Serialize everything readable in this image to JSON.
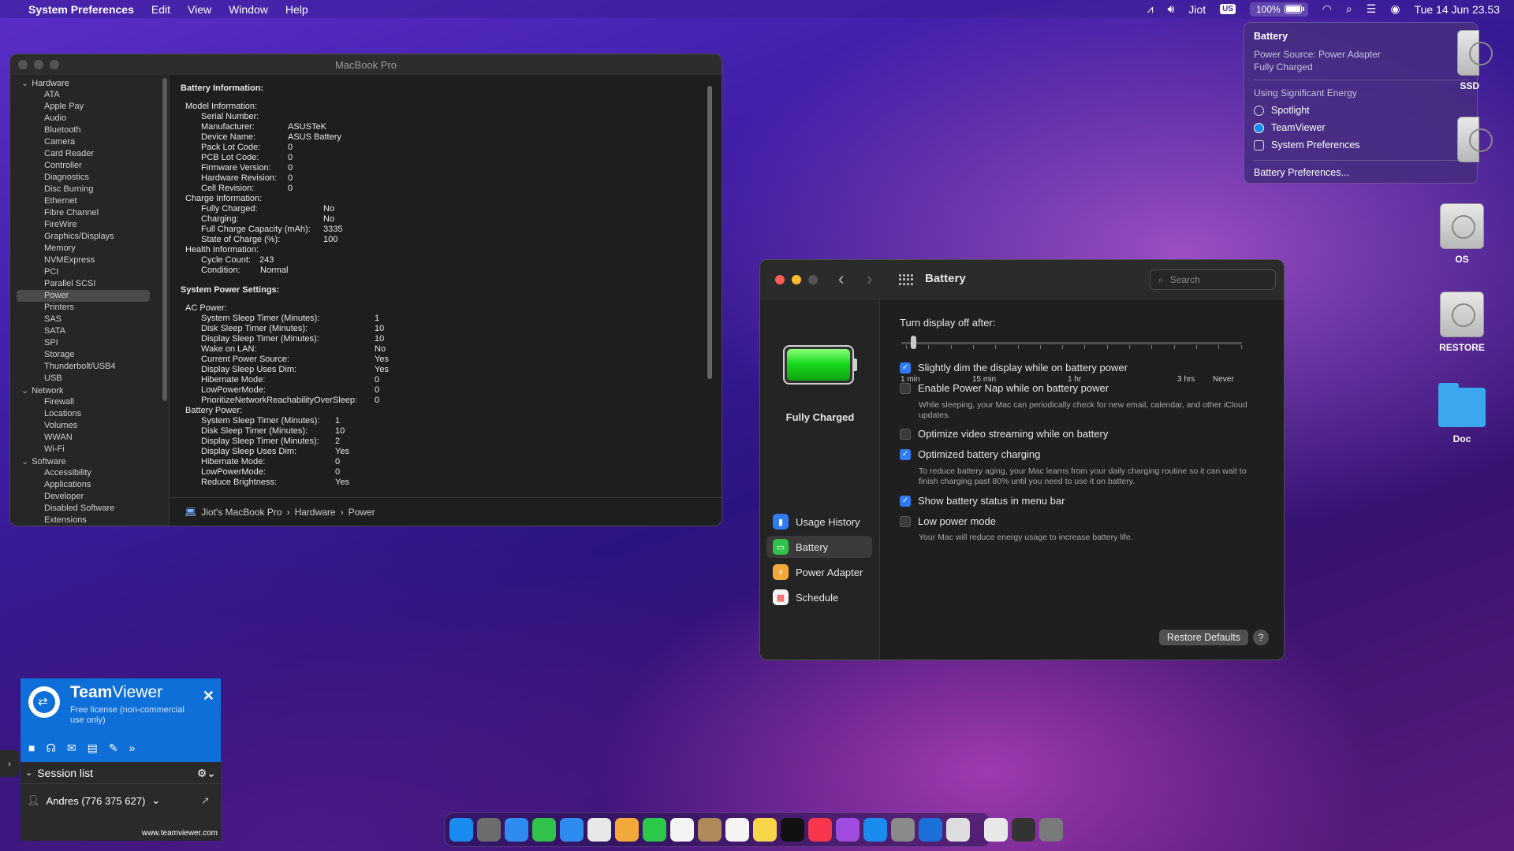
{
  "menubar": {
    "app_name": "System Preferences",
    "menus": [
      "Edit",
      "View",
      "Window",
      "Help"
    ],
    "user": "Jiot",
    "input_source": "US",
    "battery_percent": "100%",
    "datetime": "Tue 14 Jun  23.53"
  },
  "sysinfo": {
    "title": "MacBook Pro",
    "sidebar": [
      {
        "type": "cat",
        "label": "Hardware"
      },
      {
        "type": "item",
        "label": "ATA"
      },
      {
        "type": "item",
        "label": "Apple Pay"
      },
      {
        "type": "item",
        "label": "Audio"
      },
      {
        "type": "item",
        "label": "Bluetooth"
      },
      {
        "type": "item",
        "label": "Camera"
      },
      {
        "type": "item",
        "label": "Card Reader"
      },
      {
        "type": "item",
        "label": "Controller"
      },
      {
        "type": "item",
        "label": "Diagnostics"
      },
      {
        "type": "item",
        "label": "Disc Burning"
      },
      {
        "type": "item",
        "label": "Ethernet"
      },
      {
        "type": "item",
        "label": "Fibre Channel"
      },
      {
        "type": "item",
        "label": "FireWire"
      },
      {
        "type": "item",
        "label": "Graphics/Displays"
      },
      {
        "type": "item",
        "label": "Memory"
      },
      {
        "type": "item",
        "label": "NVMExpress"
      },
      {
        "type": "item",
        "label": "PCI"
      },
      {
        "type": "item",
        "label": "Parallel SCSI"
      },
      {
        "type": "item",
        "label": "Power",
        "selected": true
      },
      {
        "type": "item",
        "label": "Printers"
      },
      {
        "type": "item",
        "label": "SAS"
      },
      {
        "type": "item",
        "label": "SATA"
      },
      {
        "type": "item",
        "label": "SPI"
      },
      {
        "type": "item",
        "label": "Storage"
      },
      {
        "type": "item",
        "label": "Thunderbolt/USB4"
      },
      {
        "type": "item",
        "label": "USB"
      },
      {
        "type": "cat",
        "label": "Network"
      },
      {
        "type": "item",
        "label": "Firewall"
      },
      {
        "type": "item",
        "label": "Locations"
      },
      {
        "type": "item",
        "label": "Volumes"
      },
      {
        "type": "item",
        "label": "WWAN"
      },
      {
        "type": "item",
        "label": "Wi-Fi"
      },
      {
        "type": "cat",
        "label": "Software"
      },
      {
        "type": "item",
        "label": "Accessibility"
      },
      {
        "type": "item",
        "label": "Applications"
      },
      {
        "type": "item",
        "label": "Developer"
      },
      {
        "type": "item",
        "label": "Disabled Software"
      },
      {
        "type": "item",
        "label": "Extensions"
      }
    ],
    "battery_heading": "Battery Information:",
    "battery_rows": [
      {
        "lvl": 1,
        "k": "Model Information:",
        "v": ""
      },
      {
        "lvl": 2,
        "k": "Serial Number:",
        "v": ""
      },
      {
        "lvl": 2,
        "k": "Manufacturer:",
        "v": "ASUSTeK"
      },
      {
        "lvl": 2,
        "k": "Device Name:",
        "v": "ASUS Battery"
      },
      {
        "lvl": 2,
        "k": "Pack Lot Code:",
        "v": "0"
      },
      {
        "lvl": 2,
        "k": "PCB Lot Code:",
        "v": "0"
      },
      {
        "lvl": 2,
        "k": "Firmware Version:",
        "v": "0"
      },
      {
        "lvl": 2,
        "k": "Hardware Revision:",
        "v": "0"
      },
      {
        "lvl": 2,
        "k": "Cell Revision:",
        "v": "0"
      },
      {
        "lvl": 1,
        "k": "Charge Information:",
        "v": ""
      },
      {
        "lvl": 2,
        "k": "Fully Charged:",
        "v": "No"
      },
      {
        "lvl": 2,
        "k": "Charging:",
        "v": "No"
      },
      {
        "lvl": 2,
        "k": "Full Charge Capacity (mAh):",
        "v": "3335"
      },
      {
        "lvl": 2,
        "k": "State of Charge (%):",
        "v": "100"
      },
      {
        "lvl": 1,
        "k": "Health Information:",
        "v": ""
      },
      {
        "lvl": 2,
        "k": "Cycle Count:",
        "v": "243"
      },
      {
        "lvl": 2,
        "k": "Condition:",
        "v": "Normal"
      }
    ],
    "power_heading": "System Power Settings:",
    "power_rows": [
      {
        "lvl": 1,
        "k": "AC Power:",
        "v": ""
      },
      {
        "lvl": 2,
        "k": "System Sleep Timer (Minutes):",
        "v": "1"
      },
      {
        "lvl": 2,
        "k": "Disk Sleep Timer (Minutes):",
        "v": "10"
      },
      {
        "lvl": 2,
        "k": "Display Sleep Timer (Minutes):",
        "v": "10"
      },
      {
        "lvl": 2,
        "k": "Wake on LAN:",
        "v": "No"
      },
      {
        "lvl": 2,
        "k": "Current Power Source:",
        "v": "Yes"
      },
      {
        "lvl": 2,
        "k": "Display Sleep Uses Dim:",
        "v": "Yes"
      },
      {
        "lvl": 2,
        "k": "Hibernate Mode:",
        "v": "0"
      },
      {
        "lvl": 2,
        "k": "LowPowerMode:",
        "v": "0"
      },
      {
        "lvl": 2,
        "k": "PrioritizeNetworkReachabilityOverSleep:",
        "v": "0"
      },
      {
        "lvl": 1,
        "k": "Battery Power:",
        "v": ""
      },
      {
        "lvl": 2,
        "k": "System Sleep Timer (Minutes):",
        "v": "1"
      },
      {
        "lvl": 2,
        "k": "Disk Sleep Timer (Minutes):",
        "v": "10"
      },
      {
        "lvl": 2,
        "k": "Display Sleep Timer (Minutes):",
        "v": "2"
      },
      {
        "lvl": 2,
        "k": "Display Sleep Uses Dim:",
        "v": "Yes"
      },
      {
        "lvl": 2,
        "k": "Hibernate Mode:",
        "v": "0"
      },
      {
        "lvl": 2,
        "k": "LowPowerMode:",
        "v": "0"
      },
      {
        "lvl": 2,
        "k": "Reduce Brightness:",
        "v": "Yes"
      }
    ],
    "path": [
      "Jiot's MacBook Pro",
      "Hardware",
      "Power"
    ]
  },
  "battery_popup": {
    "title": "Battery",
    "source": "Power Source: Power Adapter",
    "state": "Fully Charged",
    "energy_heading": "Using Significant Energy",
    "apps": [
      "Spotlight",
      "TeamViewer",
      "System Preferences"
    ],
    "prefs_link": "Battery Preferences..."
  },
  "desktop": {
    "ssd": "SSD",
    "os": "OS",
    "restore": "RESTORE",
    "doc": "Doc"
  },
  "prefs": {
    "title": "Battery",
    "search_placeholder": "Search",
    "status": "Fully Charged",
    "battery_level": 1.0,
    "nav": [
      "Usage History",
      "Battery",
      "Power Adapter",
      "Schedule"
    ],
    "selected_nav": "Battery",
    "slider_label": "Turn display off after:",
    "slider_ticks": [
      "1 min",
      "15 min",
      "1 hr",
      "3 hrs",
      "Never"
    ],
    "slider_value": "1 min",
    "options": [
      {
        "label": "Slightly dim the display while on battery power",
        "checked": true,
        "desc": ""
      },
      {
        "label": "Enable Power Nap while on battery power",
        "checked": false,
        "desc": "While sleeping, your Mac can periodically check for new email, calendar, and other iCloud updates."
      },
      {
        "label": "Optimize video streaming while on battery",
        "checked": false,
        "desc": ""
      },
      {
        "label": "Optimized battery charging",
        "checked": true,
        "desc": "To reduce battery aging, your Mac learns from your daily charging routine so it can wait to finish charging past 80% until you need to use it on battery."
      },
      {
        "label": "Show battery status in menu bar",
        "checked": true,
        "desc": ""
      },
      {
        "label": "Low power mode",
        "checked": false,
        "desc": "Your Mac will reduce energy usage to increase battery life."
      }
    ],
    "restore_button": "Restore Defaults",
    "help_button": "?"
  },
  "teamviewer": {
    "brand_bold": "Team",
    "brand_light": "Viewer",
    "license": "Free license (non-commercial use only)",
    "session_list": "Session list",
    "contact": "Andres (776 375 627)",
    "site": "www.teamviewer.com"
  },
  "dock_colors": [
    "#1a8cf0",
    "#6d6d6d",
    "#2e8cf0",
    "#31c24a",
    "#2e8cf0",
    "#e8e8e8",
    "#f2a93b",
    "#2bc84a",
    "#f4f4f4",
    "#b08a5a",
    "#f4f4f4",
    "#f7d64a",
    "#111111",
    "#f6374e",
    "#a24be0",
    "#1a8cf0",
    "#8a8a8a",
    "#1a6fd8",
    "#dddddd",
    "#e8e8e8",
    "#333333",
    "#7a7a7a"
  ]
}
